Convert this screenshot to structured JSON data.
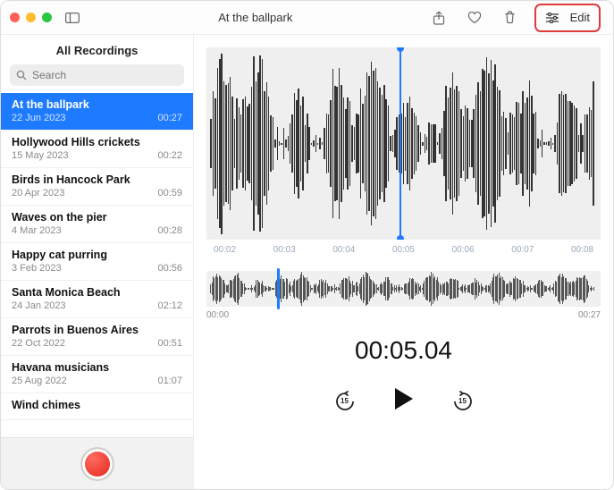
{
  "title": "At the ballpark",
  "sidebar_header": "All Recordings",
  "search_placeholder": "Search",
  "edit_label": "Edit",
  "skip_seconds": "15",
  "timecode": "00:05.04",
  "timeline": [
    "00:02",
    "00:03",
    "00:04",
    "00:05",
    "00:06",
    "00:07",
    "00:08"
  ],
  "scrub": {
    "start": "00:00",
    "end": "00:27"
  },
  "recordings": [
    {
      "name": "At the ballpark",
      "date": "22 Jun 2023",
      "dur": "00:27",
      "selected": true
    },
    {
      "name": "Hollywood Hills crickets",
      "date": "15 May 2023",
      "dur": "00:22"
    },
    {
      "name": "Birds in Hancock Park",
      "date": "20 Apr 2023",
      "dur": "00:59"
    },
    {
      "name": "Waves on the pier",
      "date": "4 Mar 2023",
      "dur": "00:28"
    },
    {
      "name": "Happy cat purring",
      "date": "3 Feb 2023",
      "dur": "00:56"
    },
    {
      "name": "Santa Monica Beach",
      "date": "24 Jan 2023",
      "dur": "02:12"
    },
    {
      "name": "Parrots in Buenos Aires",
      "date": "22 Oct 2022",
      "dur": "00:51"
    },
    {
      "name": "Havana musicians",
      "date": "25 Aug 2022",
      "dur": "01:07"
    },
    {
      "name": "Wind chimes",
      "date": "",
      "dur": ""
    }
  ]
}
